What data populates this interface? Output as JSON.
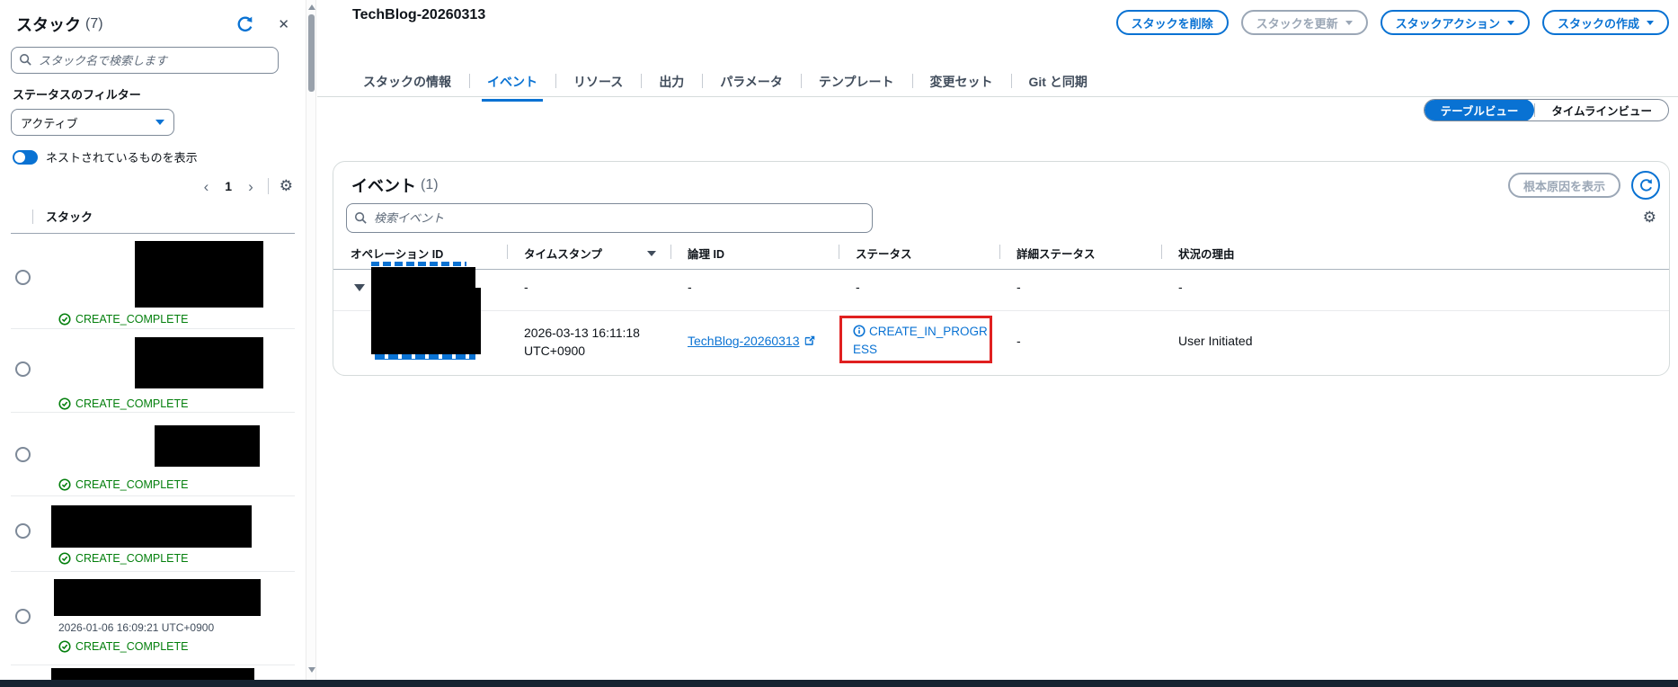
{
  "colors": {
    "accent": "#0972d3",
    "success": "#037f0c",
    "annotation_red": "#e02020",
    "disabled": "#9ba7b6"
  },
  "sidebar": {
    "title": "スタック",
    "count": "(7)",
    "search_placeholder": "スタック名で検索します",
    "filter_label": "ステータスのフィルター",
    "filter_value": "アクティブ",
    "toggle_label": "ネストされているものを表示",
    "page_number": "1",
    "column_header": "スタック",
    "rows": [
      {
        "status": "CREATE_COMPLETE"
      },
      {
        "status": "CREATE_COMPLETE"
      },
      {
        "status": "CREATE_COMPLETE"
      },
      {
        "status": "CREATE_COMPLETE"
      },
      {
        "timestamp": "2026-01-06 16:09:21 UTC+0900",
        "status": "CREATE_COMPLETE"
      },
      {}
    ]
  },
  "header": {
    "title": "TechBlog-20260313",
    "buttons": {
      "delete": "スタックを削除",
      "update": "スタックを更新",
      "actions": "スタックアクション",
      "create": "スタックの作成"
    }
  },
  "tabs": [
    "スタックの情報",
    "イベント",
    "リソース",
    "出力",
    "パラメータ",
    "テンプレート",
    "変更セット",
    "Git と同期"
  ],
  "view_toggle": {
    "table": "テーブルビュー",
    "timeline": "タイムラインビュー"
  },
  "events": {
    "title": "イベント",
    "count": "(1)",
    "root_cause_button": "根本原因を表示",
    "search_placeholder": "検索イベント",
    "columns": [
      "オペレーション ID",
      "タイムスタンプ",
      "論理 ID",
      "ステータス",
      "詳細ステータス",
      "状況の理由"
    ],
    "rows": [
      {
        "timestamp": "-",
        "logical_id": "-",
        "status": "-",
        "detail_status": "-",
        "reason": "-"
      },
      {
        "timestamp": "2026-03-13 16:11:18 UTC+0900",
        "logical_id": "TechBlog-20260313",
        "status": "CREATE_IN_PROGRESS",
        "detail_status": "-",
        "reason": "User Initiated"
      }
    ]
  }
}
